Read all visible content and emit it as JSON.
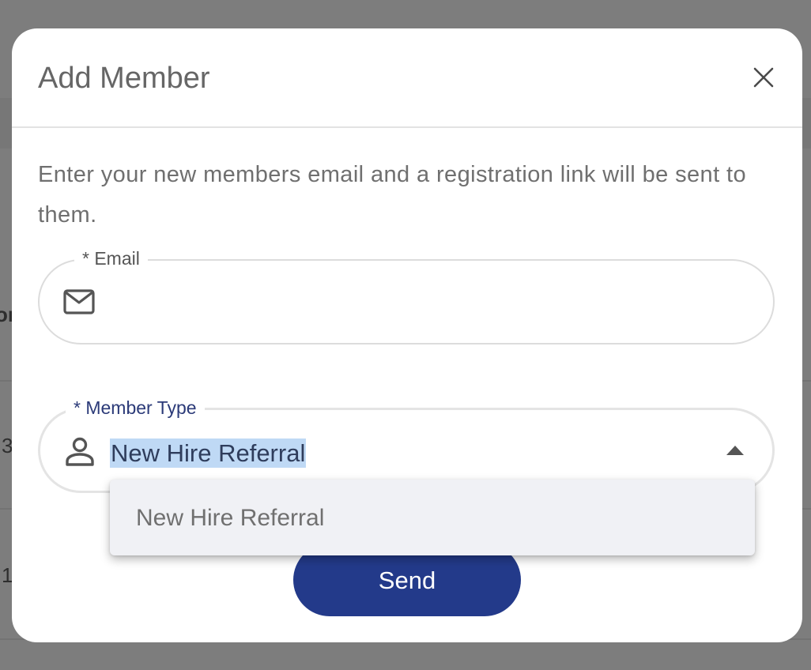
{
  "dialog": {
    "title": "Add Member",
    "description": "Enter your new members email and a registration link will be sent to them.",
    "close_icon": "close-icon"
  },
  "email_field": {
    "label": "* Email",
    "value": "",
    "placeholder": "",
    "icon": "mail-icon"
  },
  "member_type_field": {
    "label": "* Member Type",
    "selected_value": "New Hire Referral",
    "icon": "person-icon",
    "dropdown_state": "open",
    "caret_icon": "caret-up-icon"
  },
  "dropdown": {
    "options": [
      "New Hire Referral"
    ]
  },
  "actions": {
    "send_label": "Send"
  },
  "background_fragments": {
    "row1": "or",
    "row2": "3",
    "row3": "1"
  },
  "colors": {
    "primary_button": "#233a8a",
    "focused_label": "#2b3a78",
    "selection_highlight": "#bfd9f5",
    "overlay": "#7d7d7d"
  }
}
